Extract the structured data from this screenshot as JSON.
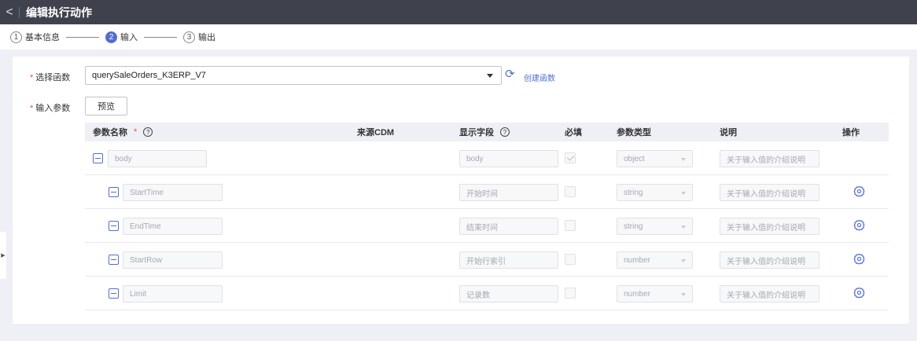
{
  "header": {
    "back_glyph": "<",
    "title": "编辑执行动作"
  },
  "steps": [
    {
      "num": "1",
      "label": "基本信息",
      "active": false
    },
    {
      "num": "2",
      "label": "输入",
      "active": true
    },
    {
      "num": "3",
      "label": "输出",
      "active": false
    }
  ],
  "form": {
    "function_label": "选择函数",
    "function_value": "querySaleOrders_K3ERP_V7",
    "refresh_icon": "refresh-icon",
    "create_function_link": "创建函数",
    "params_label": "输入参数",
    "preview_button": "预览"
  },
  "table": {
    "headers": {
      "name": "参数名称",
      "source": "来源CDM",
      "display": "显示字段",
      "required": "必填",
      "type": "参数类型",
      "description": "说明",
      "action": "操作"
    },
    "help_glyph": "?",
    "rows": [
      {
        "name": "body",
        "display": "body",
        "required": true,
        "type": "object",
        "description": "关于输入值的介绍说明",
        "has_action": false
      },
      {
        "name": "StartTime",
        "display": "开始时间",
        "required": false,
        "type": "string",
        "description": "关于输入值的介绍说明",
        "has_action": true
      },
      {
        "name": "EndTime",
        "display": "结束时间",
        "required": false,
        "type": "string",
        "description": "关于输入值的介绍说明",
        "has_action": true
      },
      {
        "name": "StartRow",
        "display": "开始行索引",
        "required": false,
        "type": "number",
        "description": "关于输入值的介绍说明",
        "has_action": true
      },
      {
        "name": "Limit",
        "display": "记录数",
        "required": false,
        "type": "number",
        "description": "关于输入值的介绍说明",
        "has_action": true
      }
    ]
  },
  "colors": {
    "accent": "#526ecc",
    "topbar": "#3f424d",
    "required_star": "#e84b4b"
  }
}
